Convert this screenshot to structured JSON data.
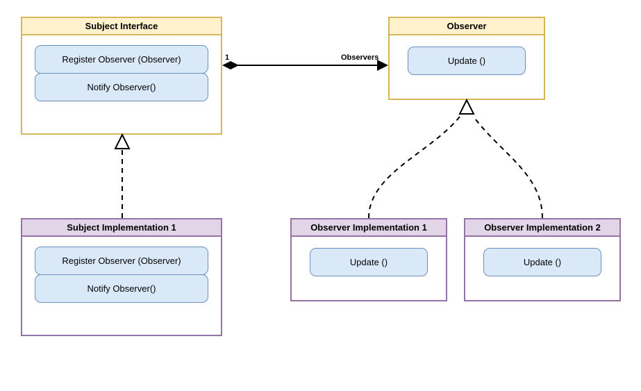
{
  "subjectInterface": {
    "title": "Subject Interface",
    "method1": "Register Observer (Observer)",
    "method2": "Notify Observer()"
  },
  "observer": {
    "title": "Observer",
    "method1": "Update ()"
  },
  "subjectImpl1": {
    "title": "Subject Implementation 1",
    "method1": "Register Observer (Observer)",
    "method2": "Notify Observer()"
  },
  "observerImpl1": {
    "title": "Observer Implementation 1",
    "method1": "Update ()"
  },
  "observerImpl2": {
    "title": "Observer Implementation 2",
    "method1": "Update ()"
  },
  "assoc": {
    "leftMultiplicity": "1",
    "rightLabel": "Observers"
  }
}
